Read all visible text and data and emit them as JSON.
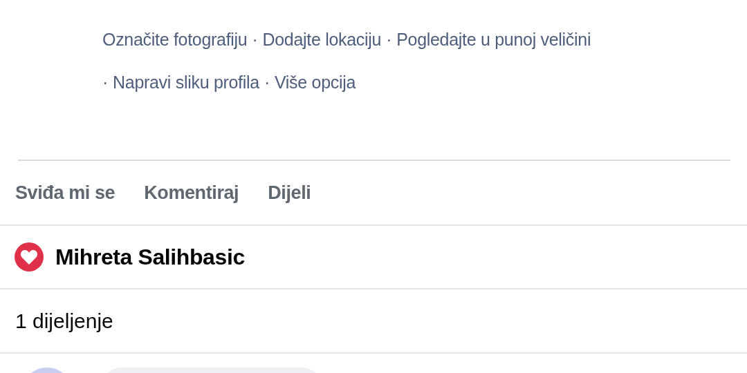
{
  "photo_links": [
    [
      {
        "text": "Označite fotografiju"
      },
      {
        "lead": "·",
        "text": "Dodajte lokaciju"
      },
      {
        "lead": "·",
        "text": "Pogledajte u punoj veličini"
      }
    ],
    [
      {
        "lead": "·",
        "text": "Napravi sliku profila"
      },
      {
        "lead": "·",
        "text": "Više opcija"
      }
    ]
  ],
  "actions": [
    "Sviđa mi se",
    "Komentiraj",
    "Dijeli"
  ],
  "reactions": [
    {
      "kind": "love",
      "name": "Mihreta Salihbasic"
    }
  ],
  "shares": "1 dijeljenje",
  "comment_box": {
    "kind": "field"
  }
}
